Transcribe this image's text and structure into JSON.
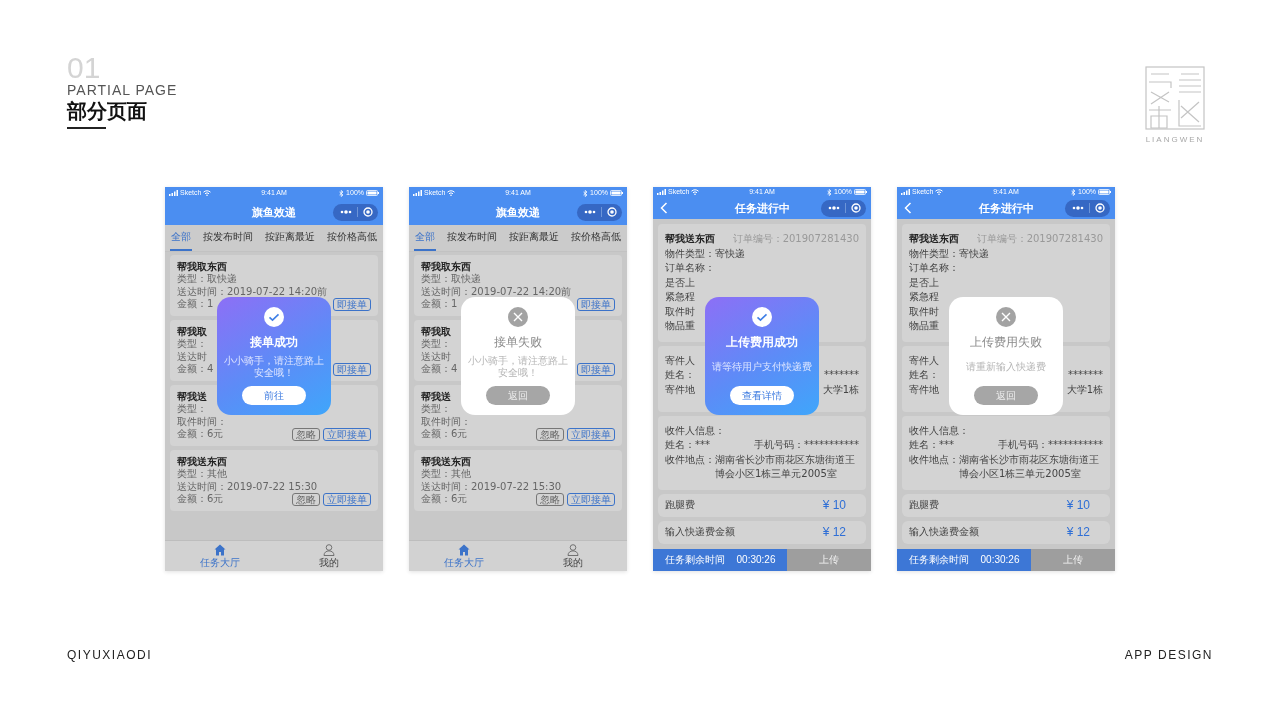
{
  "header": {
    "number": "01",
    "subtitle": "PARTIAL PAGE",
    "title": "部分页面"
  },
  "logo": {
    "caption": "LIANGWEN"
  },
  "phones": [
    {
      "kind": "hall",
      "status_bar": {
        "carrier": "Sketch",
        "time": "9:41 AM",
        "battery": "100%"
      },
      "title": "旗鱼效递",
      "tabs": [
        {
          "label": "全部",
          "selected": true
        },
        {
          "label": "按发布时间",
          "selected": false
        },
        {
          "label": "按距离最近",
          "selected": false
        },
        {
          "label": "按价格高低",
          "selected": false
        }
      ],
      "cards": [
        {
          "title": "帮我取东西",
          "lines": [
            "类型：取快递",
            "送达时间：2019-07-22 14:20前"
          ],
          "amount": "金额：1",
          "buttons": [
            {
              "label": "即接单",
              "kind": "primary"
            }
          ]
        },
        {
          "title": "帮我取",
          "lines": [
            "类型：",
            "送达时"
          ],
          "amount": "金额：4",
          "buttons": [
            {
              "label": "即接单",
              "kind": "primary"
            }
          ]
        },
        {
          "title": "帮我送",
          "lines": [
            "类型：",
            "取件时间："
          ],
          "amount": "金额：6元",
          "buttons": [
            {
              "label": "忽略",
              "kind": "ghost"
            },
            {
              "label": "立即接单",
              "kind": "primary"
            }
          ]
        },
        {
          "title": "帮我送东西",
          "lines": [
            "类型：其他",
            "送达时间：2019-07-22 15:30"
          ],
          "amount": "金额：6元",
          "buttons": [
            {
              "label": "忽略",
              "kind": "ghost"
            },
            {
              "label": "立即接单",
              "kind": "primary"
            }
          ]
        }
      ],
      "tab_bar": [
        {
          "label": "任务大厅",
          "selected": true
        },
        {
          "label": "我的",
          "selected": false
        }
      ],
      "dialog": {
        "kind": "success",
        "title": "接单成功",
        "message": "小小骑手，请注意路上安全哦！",
        "button": "前往"
      }
    },
    {
      "kind": "hall",
      "status_bar": {
        "carrier": "Sketch",
        "time": "9:41 AM",
        "battery": "100%"
      },
      "title": "旗鱼效递",
      "tabs": [
        {
          "label": "全部",
          "selected": true
        },
        {
          "label": "按发布时间",
          "selected": false
        },
        {
          "label": "按距离最近",
          "selected": false
        },
        {
          "label": "按价格高低",
          "selected": false
        }
      ],
      "cards": [
        {
          "title": "帮我取东西",
          "lines": [
            "类型：取快递",
            "送达时间：2019-07-22 14:20前"
          ],
          "amount": "金额：1",
          "buttons": [
            {
              "label": "即接单",
              "kind": "primary"
            }
          ]
        },
        {
          "title": "帮我取",
          "lines": [
            "类型：",
            "送达时"
          ],
          "amount": "金额：4",
          "buttons": [
            {
              "label": "即接单",
              "kind": "primary"
            }
          ]
        },
        {
          "title": "帮我送",
          "lines": [
            "类型：",
            "取件时间："
          ],
          "amount": "金额：6元",
          "buttons": [
            {
              "label": "忽略",
              "kind": "ghost"
            },
            {
              "label": "立即接单",
              "kind": "primary"
            }
          ]
        },
        {
          "title": "帮我送东西",
          "lines": [
            "类型：其他",
            "送达时间：2019-07-22 15:30"
          ],
          "amount": "金额：6元",
          "buttons": [
            {
              "label": "忽略",
              "kind": "ghost"
            },
            {
              "label": "立即接单",
              "kind": "primary"
            }
          ]
        }
      ],
      "tab_bar": [
        {
          "label": "任务大厅",
          "selected": true
        },
        {
          "label": "我的",
          "selected": false
        }
      ],
      "dialog": {
        "kind": "failure",
        "title": "接单失败",
        "message": "小小骑手，请注意路上安全哦！",
        "button": "返回"
      }
    },
    {
      "kind": "task",
      "status_bar": {
        "carrier": "Sketch",
        "time": "9:41 AM",
        "battery": "100%"
      },
      "title": "任务进行中",
      "sections": [
        {
          "title": "帮我送东西",
          "note": "订单编号：201907281430",
          "rows": [
            {
              "label": "物件类型：寄快递"
            },
            {
              "label": "订单名称："
            },
            {
              "label": "是否上"
            },
            {
              "label": "紧急程"
            },
            {
              "label": "取件时"
            },
            {
              "label": "物品重"
            }
          ]
        },
        {
          "rows": [
            {
              "label": "寄件人"
            },
            {
              "label": "姓名：",
              "right": "*******"
            },
            {
              "label": "寄件地",
              "right": "大学1栋"
            }
          ]
        },
        {
          "rows": [
            {
              "label": "收件人信息："
            },
            {
              "label": "姓名：***",
              "right": "手机号码：***********"
            },
            {
              "label": "收件地点：",
              "value": "湖南省长沙市雨花区东塘街道王博会小区1栋三单元2005室"
            }
          ]
        }
      ],
      "fees": [
        {
          "label": "跑腿费",
          "amount": "¥ 10"
        },
        {
          "label": "输入快递费金额",
          "amount": "¥ 12"
        }
      ],
      "timer": {
        "label": "任务剩余时间",
        "time": "00:30:26"
      },
      "upload": {
        "label": "上传",
        "disabled": true
      },
      "dialog": {
        "kind": "success",
        "title": "上传费用成功",
        "message": "请等待用户支付快递费",
        "button": "查看详情"
      }
    },
    {
      "kind": "task",
      "status_bar": {
        "carrier": "Sketch",
        "time": "9:41 AM",
        "battery": "100%"
      },
      "title": "任务进行中",
      "sections": [
        {
          "title": "帮我送东西",
          "note": "订单编号：201907281430",
          "rows": [
            {
              "label": "物件类型：寄快递"
            },
            {
              "label": "订单名称："
            },
            {
              "label": "是否上"
            },
            {
              "label": "紧急程"
            },
            {
              "label": "取件时"
            },
            {
              "label": "物品重"
            }
          ]
        },
        {
          "rows": [
            {
              "label": "寄件人"
            },
            {
              "label": "姓名：",
              "right": "*******"
            },
            {
              "label": "寄件地",
              "right": "大学1栋"
            }
          ]
        },
        {
          "rows": [
            {
              "label": "收件人信息："
            },
            {
              "label": "姓名：***",
              "right": "手机号码：***********"
            },
            {
              "label": "收件地点：",
              "value": "湖南省长沙市雨花区东塘街道王博会小区1栋三单元2005室"
            }
          ]
        }
      ],
      "fees": [
        {
          "label": "跑腿费",
          "amount": "¥ 10"
        },
        {
          "label": "输入快递费金额",
          "amount": "¥ 12"
        }
      ],
      "timer": {
        "label": "任务剩余时间",
        "time": "00:30:26"
      },
      "upload": {
        "label": "上传",
        "disabled": true
      },
      "dialog": {
        "kind": "failure",
        "title": "上传费用失败",
        "message": "请重新输入快递费",
        "button": "返回"
      }
    }
  ],
  "footer": {
    "left": "QIYUXIAODI",
    "right": "APP DESIGN"
  }
}
